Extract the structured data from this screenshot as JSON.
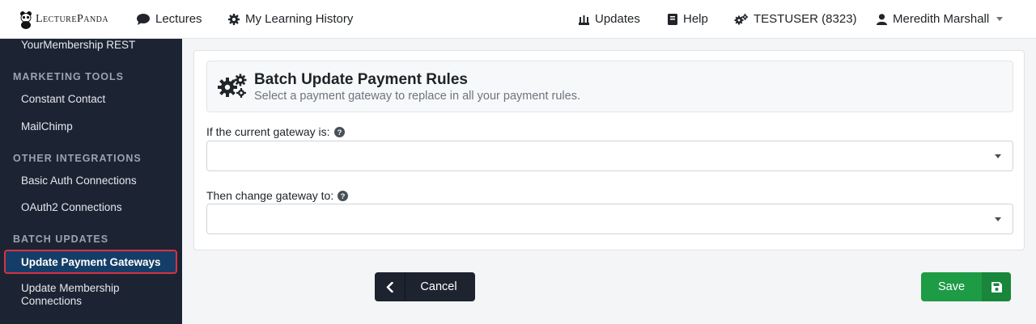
{
  "brand": {
    "name": "LecturePanda"
  },
  "nav": {
    "lectures": "Lectures",
    "history": "My Learning History",
    "updates": "Updates",
    "help": "Help",
    "account": "TESTUSER (8323)",
    "user": "Meredith Marshall"
  },
  "sidebar": {
    "top_item": "YourMembership REST",
    "sections": [
      {
        "header": "MARKETING TOOLS",
        "items": [
          "Constant Contact",
          "MailChimp"
        ]
      },
      {
        "header": "OTHER INTEGRATIONS",
        "items": [
          "Basic Auth Connections",
          "OAuth2 Connections"
        ]
      },
      {
        "header": "BATCH UPDATES",
        "items": [
          "Update Payment Gateways",
          "Update Membership Connections"
        ]
      }
    ],
    "active_item": "Update Payment Gateways"
  },
  "main": {
    "title": "Batch Update Payment Rules",
    "subtitle": "Select a payment gateway to replace in all your payment rules.",
    "field1_label": "If the current gateway is:",
    "field1_value": "",
    "field2_label": "Then change gateway to:",
    "field2_value": "",
    "cancel_label": "Cancel",
    "save_label": "Save"
  },
  "colors": {
    "sidebar_bg": "#1c2434",
    "active_bg": "#143e67",
    "highlight_border": "#d9323f",
    "save_green": "#1e9b45",
    "cancel_dark": "#1d2430"
  },
  "icons": {
    "lectures": "comment-icon",
    "history": "gear-icon",
    "updates": "sync-icon",
    "help": "book-icon",
    "account": "gears-icon",
    "user": "user-icon",
    "card": "gears-icon",
    "help_tip": "question-circle-icon",
    "cancel": "chevron-left-icon",
    "save": "floppy-disk-icon"
  }
}
